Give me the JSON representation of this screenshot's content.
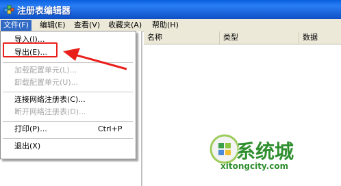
{
  "window": {
    "title": "注册表编辑器"
  },
  "menubar": {
    "items": [
      "文件(F)",
      "编辑(E)",
      "查看(V)",
      "收藏夹(A)",
      "帮助(H)"
    ]
  },
  "list_columns": [
    "名称",
    "类型",
    "数据"
  ],
  "file_menu": {
    "items": [
      {
        "label": "导入(I)...",
        "enabled": true
      },
      {
        "label": "导出(E)...",
        "enabled": true
      },
      {
        "label": "加载配置单元(L)...",
        "enabled": false
      },
      {
        "label": "卸载配置单元(U)...",
        "enabled": false
      },
      {
        "label": "连接网络注册表(C)...",
        "enabled": true
      },
      {
        "label": "断开网络注册表(D)...",
        "enabled": false
      },
      {
        "label": "打印(P)...",
        "shortcut": "Ctrl+P",
        "enabled": true
      },
      {
        "label": "退出(X)",
        "enabled": true
      }
    ]
  },
  "annotation": {
    "color": "#e8201c"
  },
  "watermark": {
    "text": "系统城",
    "url": "xitongcity.com"
  }
}
